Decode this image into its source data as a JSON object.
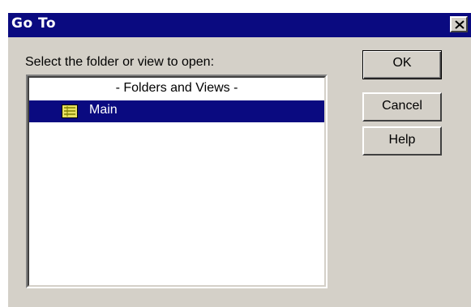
{
  "window": {
    "title": "Go To"
  },
  "dialog": {
    "prompt": "Select the folder or view to open:",
    "list": {
      "header": "- Folders and Views -",
      "items": [
        {
          "label": "Main",
          "icon": "folder-view-icon",
          "selected": true
        }
      ]
    },
    "buttons": {
      "ok": "OK",
      "cancel": "Cancel",
      "help": "Help"
    }
  },
  "colors": {
    "titlebar": "#0a0a80",
    "selection": "#0a0a80",
    "dialog_bg": "#d4d0c8",
    "icon_fill": "#e8e060"
  }
}
